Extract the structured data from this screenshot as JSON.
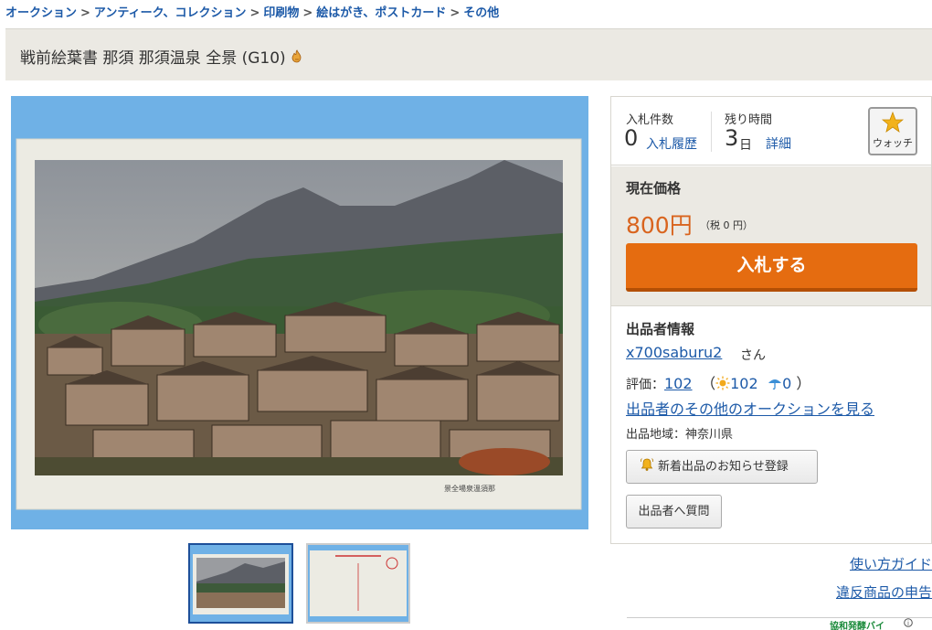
{
  "breadcrumb": {
    "items": [
      "オークション",
      "アンティーク、コレクション",
      "印刷物",
      "絵はがき、ポストカード",
      "その他"
    ],
    "separator": ">"
  },
  "item": {
    "title": "戦前絵葉書 那須 那須温泉 全景 (G10)",
    "postcard_caption": "景全場泉溫須那"
  },
  "stats": {
    "bids_label": "入札件数",
    "bids_count": "0",
    "bid_history_link": "入札履歴",
    "time_left_label": "残り時間",
    "time_left_value": "3",
    "time_left_unit": "日",
    "details_link": "詳細",
    "watch_label": "ウォッチ"
  },
  "price": {
    "label": "現在価格",
    "value": "800円",
    "tax": "（税 0 円）",
    "bid_button": "入札する"
  },
  "seller": {
    "heading": "出品者情報",
    "name": "x700saburu2",
    "suffix": "さん",
    "rating_label": "評価：",
    "rating_total": "102",
    "rating_good": "102",
    "rating_bad": "0",
    "other_auctions_link": "出品者のその他のオークションを見る",
    "location": "出品地域：神奈川県",
    "notify_button": "新着出品のお知らせ登録",
    "ask_button": "出品者へ質問"
  },
  "links": {
    "guide": "使い方ガイド",
    "report": "違反商品の申告"
  },
  "ad": {
    "text": "協和発酵バイ",
    "info_icon": "i"
  },
  "colors": {
    "link": "#1d5aa8",
    "price": "#d9641e",
    "bid_button": "#e56c10",
    "panel_bg": "#ebe9e3",
    "image_bg": "#6fb1e6"
  },
  "icons": [
    "fire-icon",
    "star-icon",
    "bell-icon",
    "sun-icon",
    "umbrella-icon",
    "info-icon"
  ]
}
